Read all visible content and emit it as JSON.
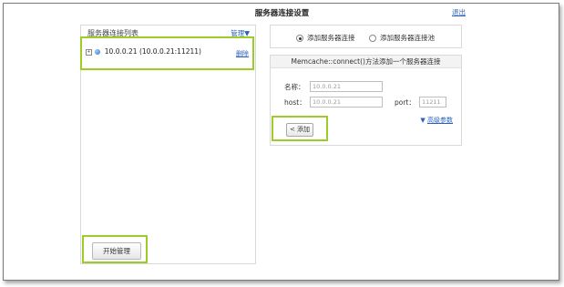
{
  "page": {
    "title": "服务器连接设置",
    "logout_label": "退出"
  },
  "server_list": {
    "title": "服务器连接列表",
    "manage_label": "管理▼",
    "items": [
      {
        "expand_symbol": "+",
        "label": "10.0.0.21   (10.0.0.21:11211)",
        "delete_label": "删除"
      }
    ],
    "start_button_label": "开始管理"
  },
  "connection_type": {
    "options": [
      {
        "label": "添加服务器连接",
        "selected": true
      },
      {
        "label": "添加服务器连接池",
        "selected": false
      }
    ]
  },
  "add_form": {
    "title": "Memcache::connect()方法添加一个服务器连接",
    "name_label": "名称：",
    "name_value": "10.0.0.21",
    "host_label": "host：",
    "host_value": "10.0.0.21",
    "port_label": "port：",
    "port_value": "11211",
    "advanced_arrow": "▼",
    "advanced_label": "高级参数",
    "add_button_label": "< 添加"
  },
  "colors": {
    "link": "#2a62b8",
    "highlight": "#9ccc27",
    "border": "#d9d9d9"
  }
}
